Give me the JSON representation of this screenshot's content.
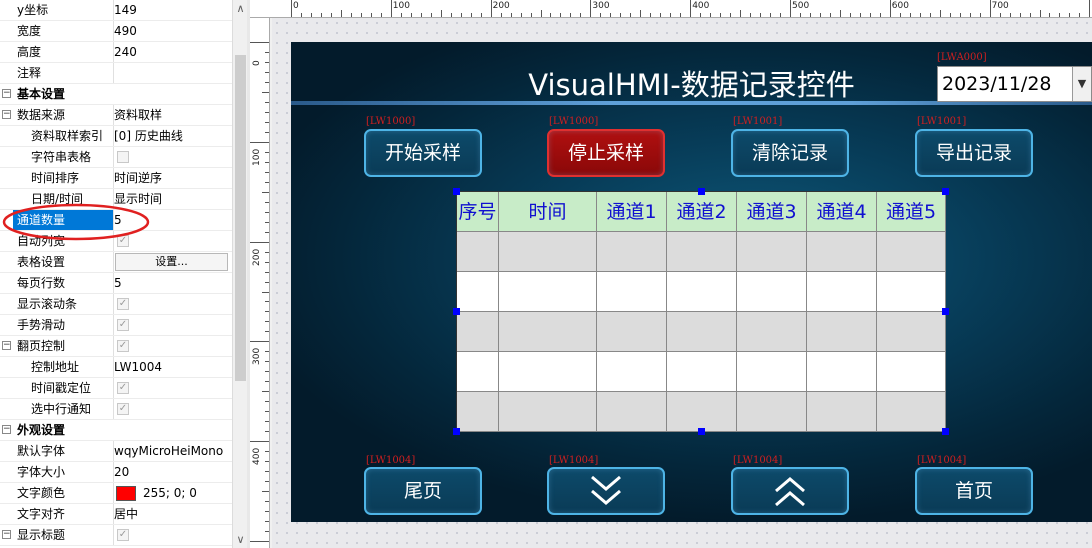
{
  "properties": [
    {
      "name": "y坐标",
      "value": "149",
      "indent": 1,
      "type": "text"
    },
    {
      "name": "宽度",
      "value": "490",
      "indent": 1,
      "type": "text"
    },
    {
      "name": "高度",
      "value": "240",
      "indent": 1,
      "type": "text"
    },
    {
      "name": "注释",
      "value": "",
      "indent": 1,
      "type": "text"
    },
    {
      "name": "基本设置",
      "value": "",
      "indent": 1,
      "type": "section",
      "expander": "⊟"
    },
    {
      "name": "数据来源",
      "value": "资料取样",
      "indent": 1,
      "type": "text",
      "expander": "⊟"
    },
    {
      "name": "资料取样索引",
      "value": "[0] 历史曲线",
      "indent": 2,
      "type": "text"
    },
    {
      "name": "字符串表格",
      "value": "",
      "indent": 2,
      "type": "checkbox-off"
    },
    {
      "name": "时间排序",
      "value": "时间逆序",
      "indent": 2,
      "type": "text"
    },
    {
      "name": "日期/时间",
      "value": "显示时间",
      "indent": 2,
      "type": "text"
    },
    {
      "name": "通道数量",
      "value": "5",
      "indent": 1,
      "type": "selected"
    },
    {
      "name": "自动列宽",
      "value": "",
      "indent": 1,
      "type": "checkbox"
    },
    {
      "name": "表格设置",
      "value": "设置...",
      "indent": 1,
      "type": "button"
    },
    {
      "name": "每页行数",
      "value": "5",
      "indent": 1,
      "type": "text"
    },
    {
      "name": "显示滚动条",
      "value": "",
      "indent": 1,
      "type": "checkbox"
    },
    {
      "name": "手势滑动",
      "value": "",
      "indent": 1,
      "type": "checkbox"
    },
    {
      "name": "翻页控制",
      "value": "",
      "indent": 1,
      "type": "checkbox",
      "expander": "⊟"
    },
    {
      "name": "控制地址",
      "value": "LW1004",
      "indent": 2,
      "type": "text"
    },
    {
      "name": "时间戳定位",
      "value": "",
      "indent": 2,
      "type": "checkbox"
    },
    {
      "name": "选中行通知",
      "value": "",
      "indent": 2,
      "type": "checkbox"
    },
    {
      "name": "外观设置",
      "value": "",
      "indent": 1,
      "type": "section",
      "expander": "⊟"
    },
    {
      "name": "默认字体",
      "value": "wqyMicroHeiMono",
      "indent": 1,
      "type": "text"
    },
    {
      "name": "字体大小",
      "value": "20",
      "indent": 1,
      "type": "text"
    },
    {
      "name": "文字颜色",
      "value": "255; 0; 0",
      "indent": 1,
      "type": "color"
    },
    {
      "name": "文字对齐",
      "value": "居中",
      "indent": 1,
      "type": "text"
    },
    {
      "name": "显示标题",
      "value": "",
      "indent": 1,
      "type": "checkbox",
      "expander": "⊟"
    }
  ],
  "scrollbar": {
    "up": "∧",
    "down": "∨"
  },
  "ruler": {
    "h_ticks": [
      "0",
      "100",
      "200",
      "300",
      "400",
      "500",
      "600",
      "700"
    ],
    "v_ticks": [
      "0",
      "100",
      "200",
      "300",
      "400"
    ]
  },
  "hmi": {
    "title": "VisualHMI-数据记录控件",
    "date_tag": "[LWA000]",
    "date_value": "2023/11/28",
    "date_dropdown": "▼",
    "top_buttons": [
      {
        "label": "开始采样",
        "tag": "[LW1000]",
        "active": false
      },
      {
        "label": "停止采样",
        "tag": "[LW1000]",
        "active": true
      },
      {
        "label": "清除记录",
        "tag": "[LW1001]",
        "active": false
      },
      {
        "label": "导出记录",
        "tag": "[LW1001]",
        "active": false
      }
    ],
    "table_headers": [
      "序号",
      "时间",
      "通道1",
      "通道2",
      "通道3",
      "通道4",
      "通道5"
    ],
    "table_rows": 5,
    "bottom_buttons": [
      {
        "label": "尾页",
        "tag": "[LW1004]",
        "icon": ""
      },
      {
        "label": "",
        "tag": "[LW1004]",
        "icon": "chevron-down-icon"
      },
      {
        "label": "",
        "tag": "[LW1004]",
        "icon": "chevron-up-icon"
      },
      {
        "label": "首页",
        "tag": "[LW1004]",
        "icon": ""
      }
    ]
  },
  "colors": {
    "highlight_oval": "#e02020",
    "selection": "#0078d7",
    "header_bg": "#c8ecc8",
    "header_text": "#1010d0",
    "row_alt": "#dcdcdc",
    "row": "#ffffff",
    "button_border": "#4eb4e6",
    "stop_button": "#b01010"
  }
}
